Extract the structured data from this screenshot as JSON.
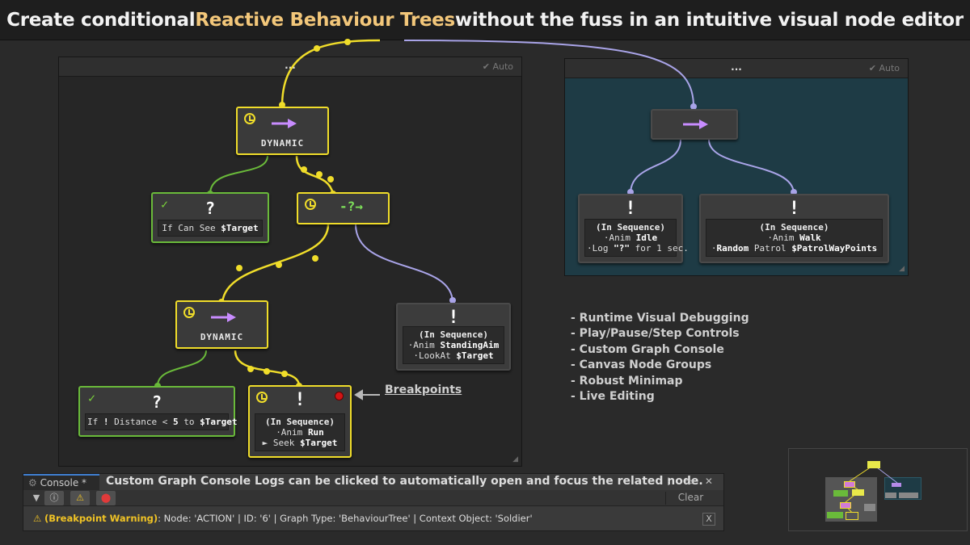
{
  "header": {
    "title_pre": "Create conditional ",
    "title_highlight": "Reactive Behaviour Trees",
    "title_post": " without the fuss in an intuitive visual node editor"
  },
  "left_panel": {
    "title": "...",
    "auto_label": "✔ Auto"
  },
  "right_panel": {
    "title": "...",
    "auto_label": "✔ Auto"
  },
  "nodes": {
    "dynamic_top": {
      "label": "DYNAMIC"
    },
    "condition_see": {
      "symbol": "?",
      "text_pre": "If Can See ",
      "text_bold": "$Target"
    },
    "reactive": {
      "symbol": "-?→"
    },
    "dynamic_bottom": {
      "label": "DYNAMIC"
    },
    "condition_distance": {
      "symbol": "?",
      "text_pre": "If ",
      "text_bang": "!",
      "text_mid": " Distance < ",
      "text_num": "5",
      "text_to": " to ",
      "text_bold": "$Target"
    },
    "action_run": {
      "symbol": "!",
      "title": "(In Sequence)",
      "line1_pre": "·Anim ",
      "line1_bold": "Run",
      "line2_pre": "► Seek ",
      "line2_bold": "$Target"
    },
    "action_aim": {
      "symbol": "!",
      "title": "(In Sequence)",
      "line1_pre": "·Anim ",
      "line1_bold": "StandingAim",
      "line2_pre": "·LookAt ",
      "line2_bold": "$Target"
    },
    "right_root": {
      "symbol": "→"
    },
    "action_idle": {
      "symbol": "!",
      "title": "(In Sequence)",
      "line1_pre": "·Anim ",
      "line1_bold": "Idle",
      "line2_pre": "·Log ",
      "line2_bold": "\"?\"",
      "line2_post": " for 1 sec."
    },
    "action_walk": {
      "symbol": "!",
      "title": "(In Sequence)",
      "line1_pre": "·Anim ",
      "line1_bold": "Walk",
      "line2_pre": "·",
      "line2_bold": "Random",
      "line2_mid": " Patrol ",
      "line2_bold2": "$PatrolWayPoints"
    }
  },
  "breakpoints_label": "Breakpoints",
  "features": [
    "- Runtime Visual Debugging",
    "- Play/Pause/Step Controls",
    "- Custom Graph Console",
    "- Canvas Node Groups",
    "- Robust Minimap",
    "- Live Editing"
  ],
  "console": {
    "tab_label": "Console *",
    "caption": "Custom Graph Console Logs can be clicked to automatically open and focus the related node.",
    "clear_label": "Clear",
    "message_prefix": "(Breakpoint Warning)",
    "message_body": ": Node: 'ACTION' | ID: '6' | Graph Type: 'BehaviourTree' | Context Object: 'Soldier'",
    "close_label": "X",
    "window_icons": "⋮ ▭ ✕"
  },
  "colors": {
    "active_yellow": "#f0dd2a",
    "condition_green": "#6aba3a",
    "inactive_lavender": "#a9a4e8",
    "highlight_text": "#f3c77a",
    "right_canvas": "#1e3b45"
  }
}
